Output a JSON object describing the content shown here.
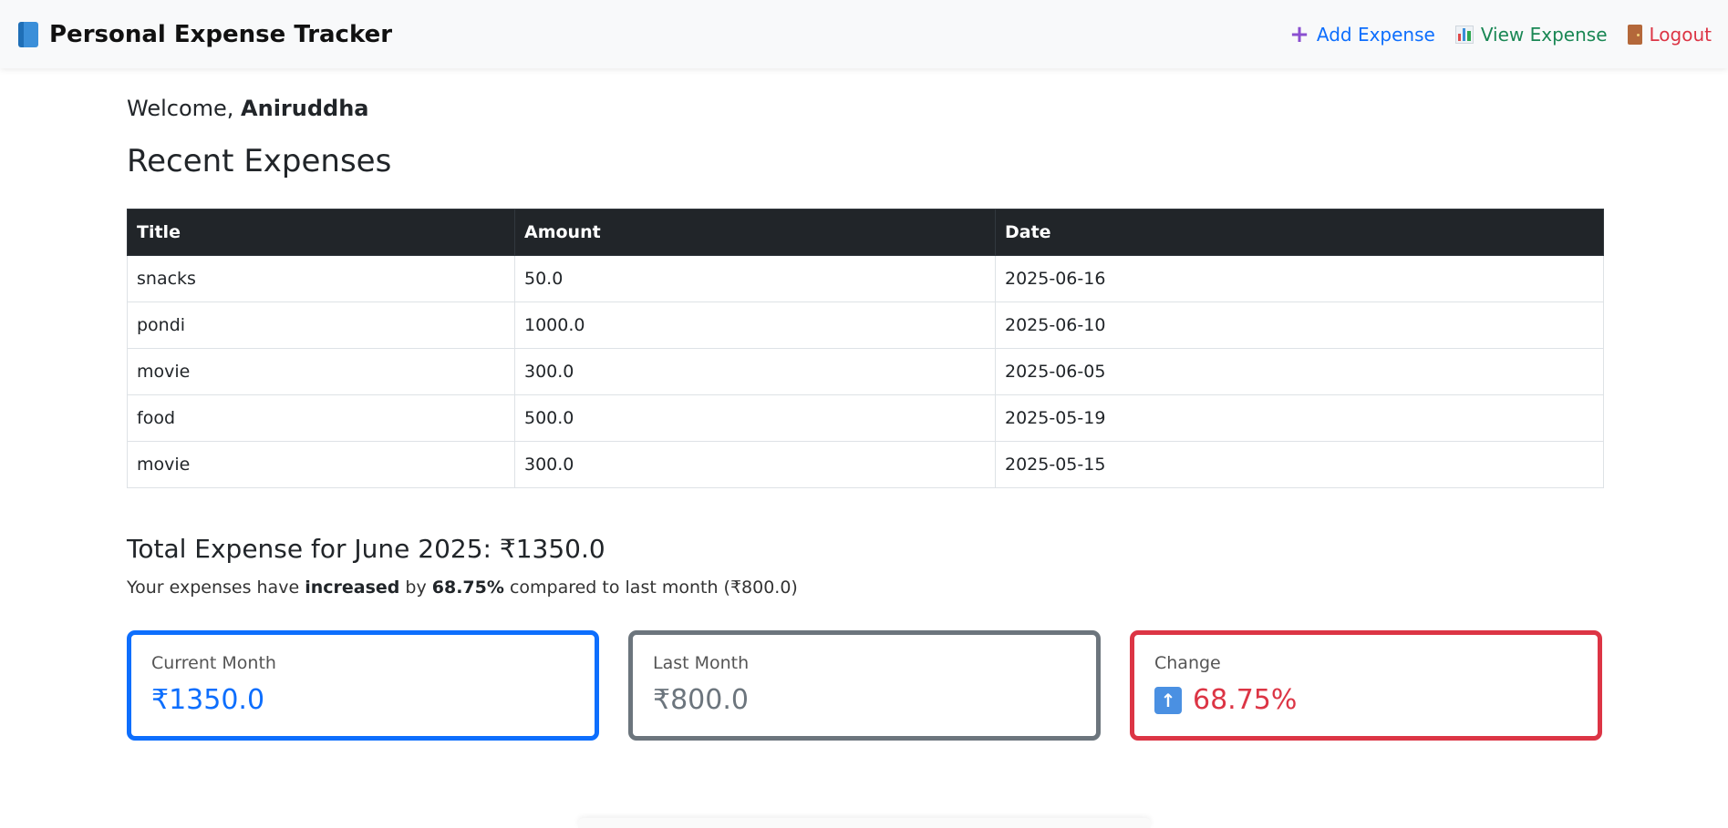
{
  "navbar": {
    "brand": "Personal Expense Tracker",
    "add_label": "Add Expense",
    "view_label": "View Expense",
    "logout_label": "Logout"
  },
  "welcome": {
    "prefix": "Welcome, ",
    "user": "Aniruddha"
  },
  "recent": {
    "title": "Recent Expenses",
    "headers": [
      "Title",
      "Amount",
      "Date"
    ],
    "rows": [
      [
        "snacks",
        "50.0",
        "2025-06-16"
      ],
      [
        "pondi",
        "1000.0",
        "2025-06-10"
      ],
      [
        "movie",
        "300.0",
        "2025-06-05"
      ],
      [
        "food",
        "500.0",
        "2025-05-19"
      ],
      [
        "movie",
        "300.0",
        "2025-05-15"
      ]
    ]
  },
  "summary": {
    "heading": "Total Expense for June 2025: ₹1350.0",
    "text_prefix": "Your expenses have ",
    "direction": "increased",
    "text_mid": " by ",
    "percent": "68.75%",
    "text_suffix": " compared to last month (₹800.0)"
  },
  "cards": {
    "current_label": "Current Month",
    "current_value": "₹1350.0",
    "last_label": "Last Month",
    "last_value": "₹800.0",
    "change_label": "Change",
    "change_value": "68.75%"
  },
  "colors": {
    "primary": "#0d6efd",
    "secondary": "#6c757d",
    "danger": "#dc3545",
    "success": "#198754",
    "dark": "#212529"
  }
}
